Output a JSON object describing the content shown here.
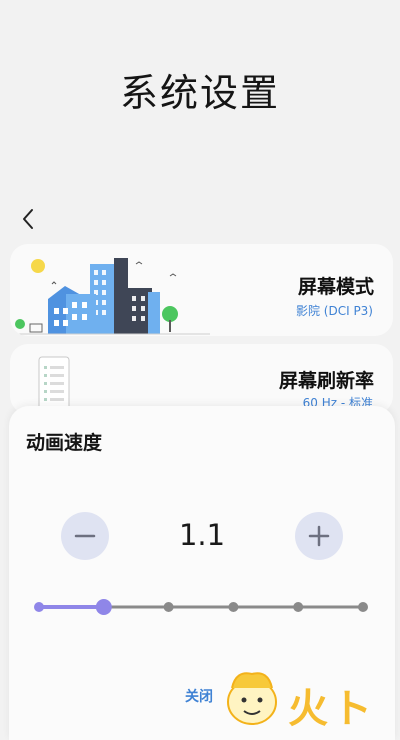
{
  "header": {
    "title": "系统设置",
    "back_icon": "chevron-left-icon"
  },
  "cards": {
    "screen_mode": {
      "title": "屏幕模式",
      "subtitle": "影院 (DCI P3)"
    },
    "refresh_rate": {
      "title": "屏幕刷新率",
      "subtitle": "60 Hz - 标准"
    }
  },
  "sheet": {
    "title": "动画速度",
    "value": "1.1",
    "minus_icon": "minus-icon",
    "plus_icon": "plus-icon",
    "slider": {
      "steps": 6,
      "selected_index": 1
    },
    "close_label": "关闭"
  },
  "watermark": {
    "text": "火ト"
  },
  "colors": {
    "accent": "#3f82d4",
    "slider_active": "#8f86e8",
    "slider_inactive": "#8a8a8a",
    "round_button": "#dfe3f2"
  }
}
